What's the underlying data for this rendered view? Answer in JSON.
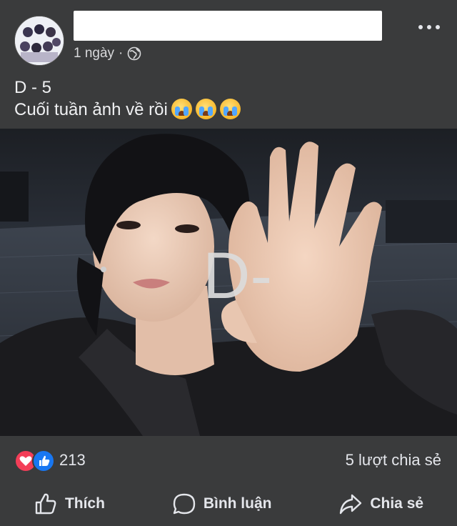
{
  "post": {
    "time": "1 ngày",
    "separator": "·",
    "privacy_icon": "globe-icon",
    "line1": "D - 5",
    "line2": "Cuối tuần ảnh về rồi",
    "emoji_icon": "loudly-crying-face-emoji",
    "emoji_count": 3
  },
  "photo": {
    "overlay_text": "D-"
  },
  "stats": {
    "reactions": [
      "love-reaction-icon",
      "like-reaction-icon"
    ],
    "reaction_count": "213",
    "share_count": "5 lượt chia sẻ"
  },
  "actions": {
    "like": "Thích",
    "comment": "Bình luận",
    "share": "Chia sẻ"
  },
  "colors": {
    "background": "#3a3b3c",
    "text": "#e4e6eb",
    "like_blue": "#1877f2",
    "love_red": "#f33e58"
  }
}
